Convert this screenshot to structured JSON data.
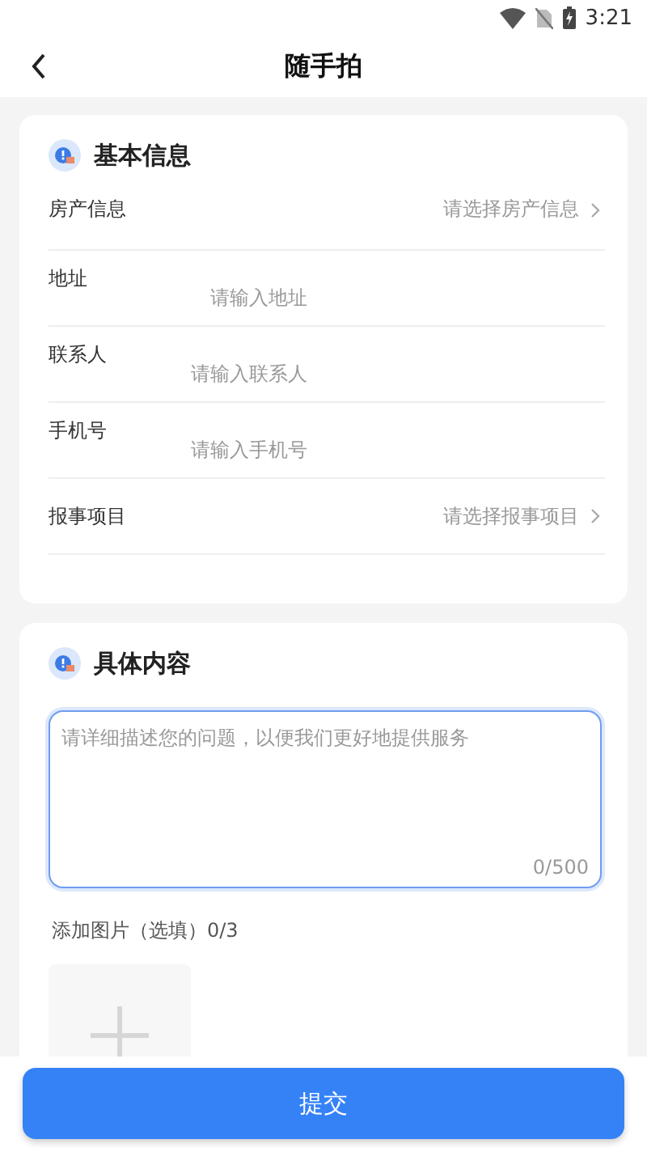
{
  "status_bar": {
    "time": "3:21"
  },
  "header": {
    "title": "随手拍"
  },
  "basic_info": {
    "title": "基本信息",
    "rows": [
      {
        "kind": "select",
        "label": "房产信息",
        "placeholder": "请选择房产信息"
      },
      {
        "kind": "input",
        "label": "地址",
        "placeholder": "请输入地址"
      },
      {
        "kind": "input",
        "label": "联系人",
        "placeholder": "请输入联系人"
      },
      {
        "kind": "input",
        "label": "手机号",
        "placeholder": "请输入手机号"
      },
      {
        "kind": "select",
        "label": "报事项目",
        "placeholder": "请选择报事项目"
      }
    ]
  },
  "details": {
    "title": "具体内容",
    "description": {
      "placeholder": "请详细描述您的问题，以便我们更好地提供服务",
      "counter": "0/500"
    },
    "photos": {
      "label": "添加图片（选填）0/3"
    }
  },
  "submit": {
    "label": "提交"
  }
}
